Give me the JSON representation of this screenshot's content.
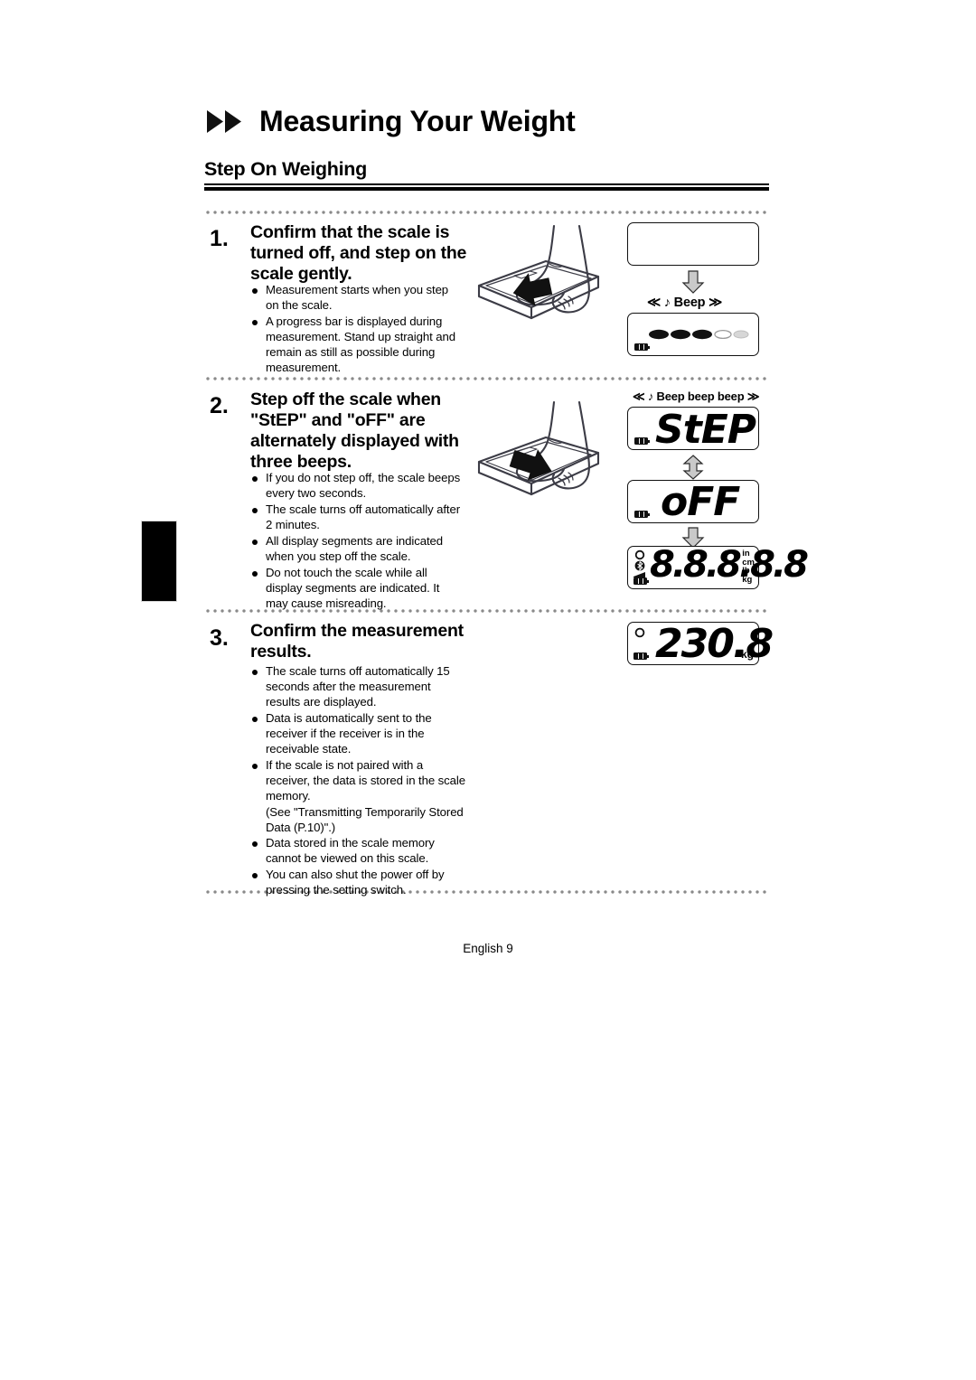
{
  "document": {
    "title": "Measuring Your Weight",
    "section_heading": "Step On Weighing",
    "footer": "English 9"
  },
  "steps": [
    {
      "number": "1.",
      "heading": "Confirm that the scale is turned off, and step on the scale gently.",
      "bullets": [
        "Measurement starts when you step on the scale.",
        "A progress bar is displayed during measurement. Stand up straight and remain as still as possible during measurement."
      ],
      "illustration": "foot-stepping-on-scale",
      "displays": [
        {
          "name": "blank-display",
          "value": "",
          "caption": ""
        },
        {
          "name": "progress-bar-display",
          "value": "",
          "caption": "≪ ♪ Beep ≫"
        }
      ]
    },
    {
      "number": "2.",
      "heading": "Step off the scale when \"StEP\" and \"oFF\" are alternately displayed with three beeps.",
      "bullets": [
        "If you do not step off, the scale beeps every two seconds.",
        "The scale turns off automatically after 2 minutes.",
        "All display segments are indicated when you step off the scale.",
        "Do not touch the scale while all display segments are indicated. It may cause misreading."
      ],
      "illustration": "foot-stepping-off-scale",
      "displays": [
        {
          "name": "step-display",
          "value": "StEP",
          "caption": "≪ ♪ Beep beep beep ≫"
        },
        {
          "name": "off-display",
          "value": "oFF",
          "caption": ""
        },
        {
          "name": "all-segments-display",
          "value": "8.8.8.8.8",
          "caption": "",
          "units": [
            "in",
            "cm",
            "lb",
            "kg"
          ]
        }
      ]
    },
    {
      "number": "3.",
      "heading": "Confirm the measurement results.",
      "bullets": [
        "The scale turns off automatically 15 seconds after the measurement results are displayed.",
        "Data is automatically sent to the receiver if the receiver is in the receivable state.",
        "If the scale is not paired with a receiver, the data is stored in the scale memory.",
        "(See \"Transmitting Temporarily Stored Data (P.10)\".)",
        "Data stored in the scale memory cannot be viewed on this scale.",
        "You can also shut the power off by pressing the setting switch."
      ],
      "illustration": "",
      "displays": [
        {
          "name": "result-display",
          "value": "230.8",
          "caption": "",
          "units": [
            "kg"
          ]
        }
      ]
    }
  ],
  "colors": {
    "ink": "#000000",
    "page": "#ffffff",
    "dotted_rule": "#8a8a8a",
    "arrow_fill": "#c9c9c9"
  }
}
